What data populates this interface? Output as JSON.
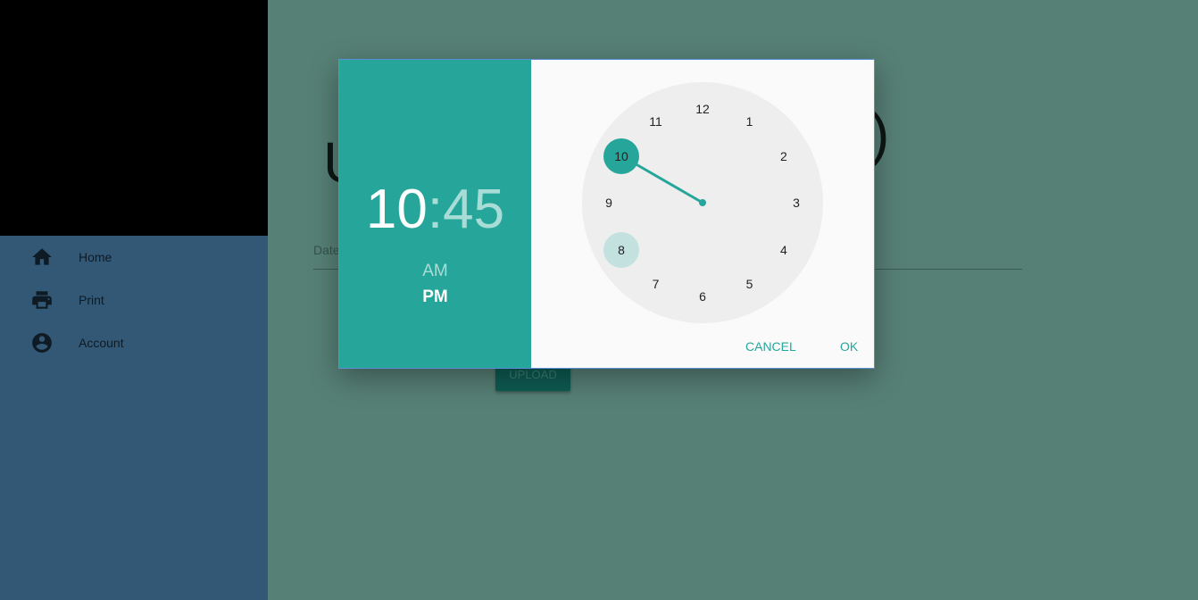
{
  "sidebar": {
    "items": [
      {
        "label": "Home",
        "icon": "home-icon"
      },
      {
        "label": "Print",
        "icon": "printer-icon"
      },
      {
        "label": "Account",
        "icon": "account-circle-icon"
      }
    ]
  },
  "main": {
    "date_label": "Date",
    "upload_label": "UPLOAD"
  },
  "time_picker": {
    "hours": "10",
    "separator": ":",
    "minutes": "45",
    "am_label": "AM",
    "pm_label": "PM",
    "selected_period": "PM",
    "selected_hour": 10,
    "hovered_hour": 8,
    "dial_numbers": [
      "12",
      "1",
      "2",
      "3",
      "4",
      "5",
      "6",
      "7",
      "8",
      "9",
      "10",
      "11"
    ],
    "cancel_label": "CANCEL",
    "ok_label": "OK"
  },
  "colors": {
    "accent": "#26a69a",
    "sidebar": "#335876",
    "backdrop": "#567f75"
  }
}
